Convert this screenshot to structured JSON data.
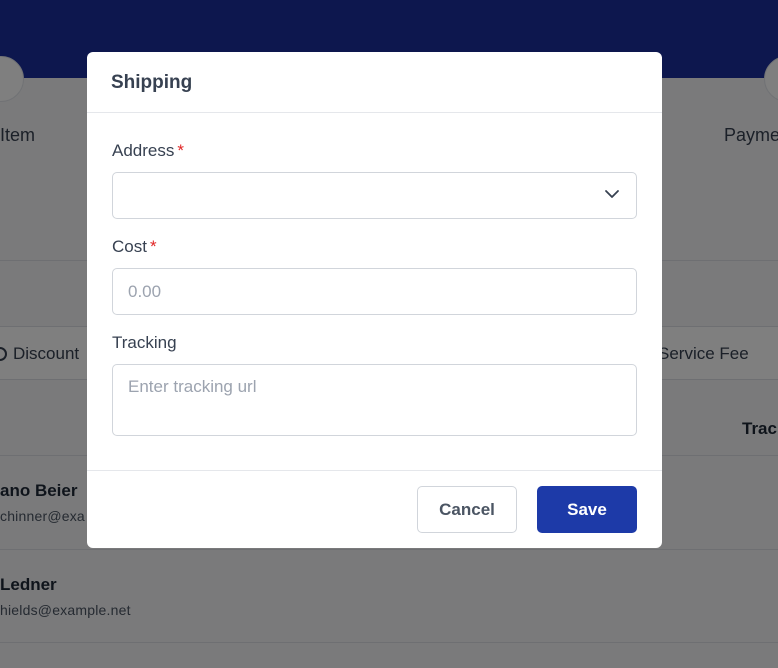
{
  "background": {
    "steps": [
      "Item",
      "Payme"
    ],
    "summary": {
      "discount_label": "Discount",
      "service_fee_label": "Service Fee"
    },
    "table": {
      "header_partial": "Trac",
      "rows": [
        {
          "name": "ano Beier",
          "email": "chinner@exa"
        },
        {
          "name": "Ledner",
          "email": "hields@example.net"
        }
      ]
    }
  },
  "modal": {
    "title": "Shipping",
    "address": {
      "label": "Address",
      "required_mark": "*",
      "value": ""
    },
    "cost": {
      "label": "Cost",
      "required_mark": "*",
      "placeholder": "0.00"
    },
    "tracking": {
      "label": "Tracking",
      "placeholder": "Enter tracking url"
    },
    "cancel_label": "Cancel",
    "save_label": "Save"
  },
  "colors": {
    "topbar": "#1a2f9c",
    "primary_button": "#1d3aa8",
    "required": "#e02424"
  }
}
